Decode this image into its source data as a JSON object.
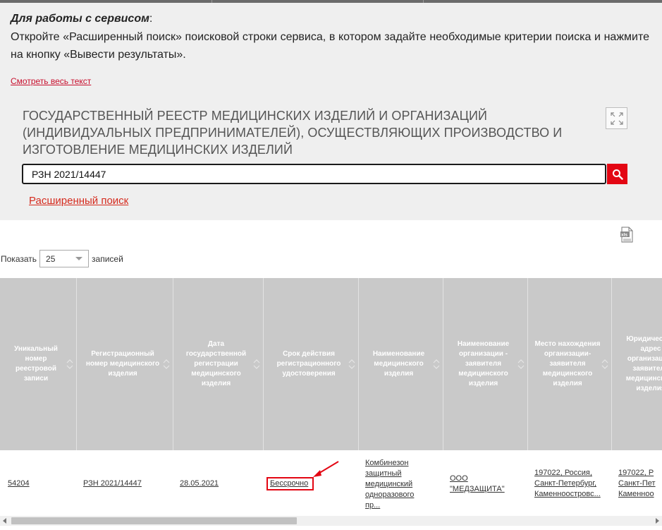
{
  "intro": {
    "heading": "Для работы с сервисом",
    "heading_suffix": ":",
    "text": "Откройте «Расширенный поиск» поисковой строки сервиса, в котором задайте необходимые критерии поиска и нажмите на кнопку «Вывести результаты».",
    "see_all_link": "Смотреть весь текст"
  },
  "registry": {
    "title": "ГОСУДАРСТВЕННЫЙ РЕЕСТР МЕДИЦИНСКИХ ИЗДЕЛИЙ И ОРГАНИЗАЦИЙ (ИНДИВИДУАЛЬНЫХ ПРЕДПРИНИМАТЕЛЕЙ), ОСУЩЕСТВЛЯЮЩИХ ПРОИЗВОДСТВО И ИЗГОТОВЛЕНИЕ МЕДИЦИНСКИХ ИЗДЕЛИЙ",
    "search_value": "РЗН 2021/14447",
    "advanced_search": "Расширенный поиск"
  },
  "controls": {
    "show_label": "Показать",
    "page_size": "25",
    "records_label": "записей"
  },
  "table": {
    "columns": [
      "Уникальный номер реестровой записи",
      "Регистрационный номер медицинского изделия",
      "Дата государственной регистрации медицинского изделия",
      "Срок действия регистрационного удостоверения",
      "Наименование медицинского изделия",
      "Наименование организации - заявителя медицинского изделия",
      "Место нахождения организации-заявителя медицинского изделия",
      "Юридический адрес организации-заявителя медицинского изделия"
    ],
    "row": {
      "id": "54204",
      "reg_number": "РЗН 2021/14447",
      "reg_date": "28.05.2021",
      "validity": "Бессрочно",
      "name_lines": [
        "Комбинезон",
        "защитный",
        "медицинский",
        "одноразового",
        "пр..."
      ],
      "org_lines": [
        "ООО",
        "\"МЕДЗАЩИТА\""
      ],
      "location_lines": [
        "197022, Россия,",
        "Санкт-Петербург,",
        "Каменноостровс..."
      ],
      "legal_lines": [
        "197022, Р",
        "Санкт-Пет",
        "Каменноо"
      ]
    }
  },
  "colors": {
    "accent_red": "#e30613",
    "link_red": "#d52b1e",
    "header_gray": "#c9c9c9",
    "panel_bg": "#efefef"
  }
}
